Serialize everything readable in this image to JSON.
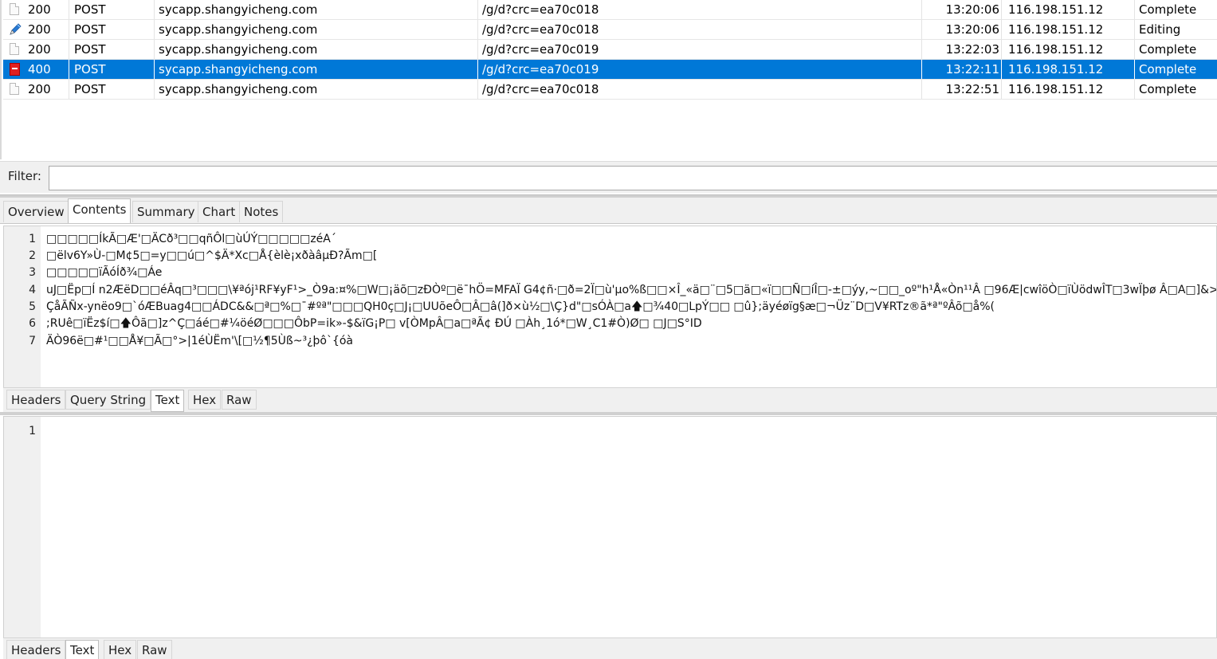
{
  "requests": [
    {
      "icon": "document-icon",
      "code": "200",
      "method": "POST",
      "host": "sycapp.shangyicheng.com",
      "path": "/g/d?crc=ea70c018",
      "time": "13:20:06",
      "ip": "116.198.151.12",
      "state": "Complete"
    },
    {
      "icon": "edit-pen-icon",
      "code": "200",
      "method": "POST",
      "host": "sycapp.shangyicheng.com",
      "path": "/g/d?crc=ea70c018",
      "time": "13:20:06",
      "ip": "116.198.151.12",
      "state": "Editing"
    },
    {
      "icon": "document-icon",
      "code": "200",
      "method": "POST",
      "host": "sycapp.shangyicheng.com",
      "path": "/g/d?crc=ea70c019",
      "time": "13:22:03",
      "ip": "116.198.151.12",
      "state": "Complete"
    },
    {
      "icon": "error-document-icon",
      "code": "400",
      "method": "POST",
      "host": "sycapp.shangyicheng.com",
      "path": "/g/d?crc=ea70c019",
      "time": "13:22:11",
      "ip": "116.198.151.12",
      "state": "Complete",
      "selected": true
    },
    {
      "icon": "document-icon",
      "code": "200",
      "method": "POST",
      "host": "sycapp.shangyicheng.com",
      "path": "/g/d?crc=ea70c018",
      "time": "13:22:51",
      "ip": "116.198.151.12",
      "state": "Complete"
    }
  ],
  "filter": {
    "label": "Filter:",
    "value": ""
  },
  "main_tabs": [
    {
      "label": "Overview",
      "active": false
    },
    {
      "label": "Contents",
      "active": true
    },
    {
      "label": "Summary",
      "active": false
    },
    {
      "label": "Chart",
      "active": false
    },
    {
      "label": "Notes",
      "active": false
    }
  ],
  "request_body": {
    "lines": [
      {
        "num": "1",
        "text": "□□□□□ÍkÃ□Æ'□ÄCð³□□qñÔl□ùÚÝ□□□□□zéA´"
      },
      {
        "num": "2",
        "text": "□ëlv6Y»Ù-□M¢5□=y□□ú□^$Ä*Xc□Å{èlè¡xðàâµÐ?Ãm□["
      },
      {
        "num": "3",
        "text": "□□□□□ïÃóÍð¾□Áe"
      },
      {
        "num": "4",
        "text": "uJ□Ëp□Í n2ÆëD□□éÂq□³□□□\\¥ªój¹RF¥yF¹>_Ò9a:¤%□W□¡äõ□zÐÒº□ë¯hÖ=MFAÏ G4¢ñ·□ð=2Ï□ù'µo%ß□□×Î_«ä□¨□5□ä□«ï□□Ñ□íÎ□-±□ýy,~□□_oº\"h¹Å«Òn¹¹Â □96Æ|cwîöÒ□ïÙödwÎT□3wÏþø Â□A□]&>!Èà,F□ÎR"
      },
      {
        "num": "5",
        "text": "ÇåÃÑx-ynëo9□`óÆBuag4□□ÁDC&&□ª□%□¯#ºª\"□□□QH0ç□J¡□UUõeÔ□Â□â(]ð×ù½□\\Ç}d\"□sÓÀ□a🡅□¾40□LpÝ□□ □û};äyéøïg§æ□¬Üz¨D□V¥RTz®ã*ª\"ºÂõ□å%("
      },
      {
        "num": "6",
        "text": ";RUê□ïËz$í□🡅Ôã□]z^Ç□áé□#¼öéØ□□□ÔbP=ik»-$&ïG¡P□          v[ÒMpÂ□a□ªÃ¢ ÐÚ □Àh¸1ó*□W¸C1#Ò)Ø□ □J□S°ID"
      },
      {
        "num": "7",
        "text": "ÄÒ96ë□#¹□□Å¥□Ã□°>|1éÙËm'\\[□½¶5Ùß~³¿þô`{óà"
      }
    ]
  },
  "request_subtabs": [
    {
      "label": "Headers",
      "active": false
    },
    {
      "label": "Query String",
      "active": false
    },
    {
      "label": "Text",
      "active": true
    },
    {
      "label": "Hex",
      "active": false
    },
    {
      "label": "Raw",
      "active": false
    }
  ],
  "response_body": {
    "lines": [
      {
        "num": "1",
        "text": ""
      }
    ]
  },
  "response_subtabs": [
    {
      "label": "Headers",
      "active": false
    },
    {
      "label": "Text",
      "active": true
    },
    {
      "label": "Hex",
      "active": false
    },
    {
      "label": "Raw",
      "active": false
    }
  ],
  "colors": {
    "selection": "#0078d7",
    "error_icon": "#e02020",
    "pen_icon": "#2a7bd4"
  }
}
